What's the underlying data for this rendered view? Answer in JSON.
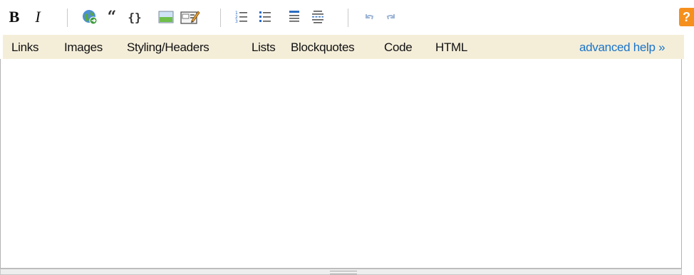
{
  "toolbar": {
    "bold_label": "B",
    "italic_label": "I",
    "buttons": [
      "link-icon",
      "blockquote-icon",
      "code-icon",
      "image-icon",
      "snippet-icon",
      "ordered-list-icon",
      "bulleted-list-icon",
      "heading-icon",
      "horizontal-rule-icon",
      "undo-icon",
      "redo-icon"
    ],
    "quote_glyph": "66",
    "code_glyph": "{}",
    "help_label": "?",
    "accent": "#f5901e"
  },
  "helpbar": {
    "items": [
      "Links",
      "Images",
      "Styling/Headers",
      "Lists",
      "Blockquotes",
      "Code",
      "HTML"
    ],
    "advanced": "advanced help »",
    "background": "#f4eed9",
    "link_color": "#1a73c8"
  },
  "editor": {
    "value": ""
  }
}
